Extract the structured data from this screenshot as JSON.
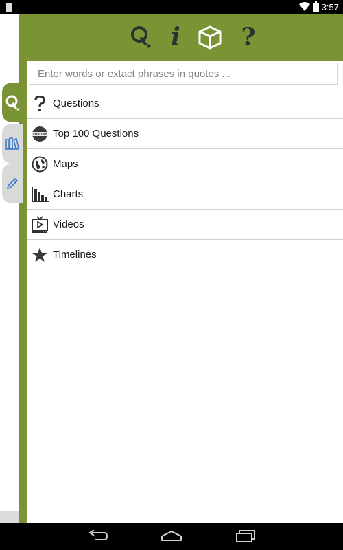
{
  "status_bar": {
    "time": "3:57",
    "icons": [
      "notification-icon",
      "wifi-icon",
      "battery-icon"
    ]
  },
  "header": {
    "icons": [
      "search-q-icon",
      "info-icon",
      "cube-icon",
      "question-icon"
    ],
    "info_glyph": "i",
    "question_glyph": "?"
  },
  "side_tabs": [
    "search-tab",
    "library-tab",
    "notes-tab"
  ],
  "search": {
    "placeholder": "Enter words or extact phrases in quotes ..."
  },
  "menu": {
    "items": [
      {
        "label": "Questions",
        "icon": "question-icon"
      },
      {
        "label": "Top 100 Questions",
        "icon": "top-100-badge-icon",
        "badge_text": "TOP 100"
      },
      {
        "label": "Maps",
        "icon": "globe-icon"
      },
      {
        "label": "Charts",
        "icon": "bar-chart-icon"
      },
      {
        "label": "Videos",
        "icon": "tv-icon"
      },
      {
        "label": "Timelines",
        "icon": "star-icon"
      }
    ]
  },
  "colors": {
    "brand_green": "#7a9335",
    "icon_dark": "#2f2f2f",
    "tab_inactive": "#d9d9d9",
    "pencil_blue": "#3a78c9"
  },
  "nav_bar": {
    "buttons": [
      "back-button",
      "home-button",
      "recents-button"
    ]
  }
}
